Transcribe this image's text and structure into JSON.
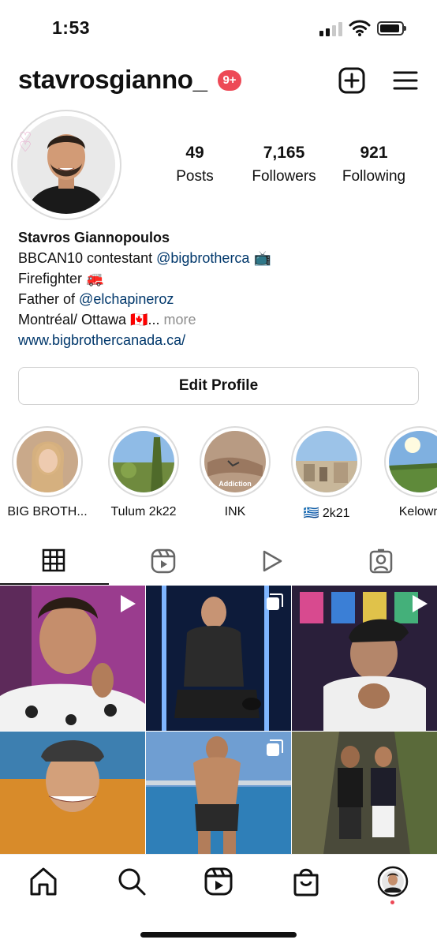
{
  "status_bar": {
    "time": "1:53",
    "signal_icon": "cellular-signal-icon",
    "wifi_icon": "wifi-icon",
    "battery_icon": "battery-icon"
  },
  "header": {
    "username": "stavrosgianno_",
    "notification_badge": "9+",
    "new_post_icon": "plus-square-icon",
    "menu_icon": "hamburger-menu-icon",
    "accent_color": "#ed4956"
  },
  "profile": {
    "avatar_icon": "profile-photo",
    "stats": [
      {
        "value": "49",
        "label": "Posts"
      },
      {
        "value": "7,165",
        "label": "Followers"
      },
      {
        "value": "921",
        "label": "Following"
      }
    ],
    "name": "Stavros Giannopoulos",
    "bio": {
      "line1_text": "BBCAN10 contestant ",
      "line1_mention": "@bigbrotherca",
      "line1_emoji": "📺",
      "line2": "Firefighter 🚒",
      "line3_text": "Father of ",
      "line3_mention": "@elchapineroz",
      "line4_text": "Montréal/ Ottawa 🇨🇦...",
      "line4_more": " more",
      "website": "www.bigbrothercanada.ca/"
    },
    "link_color": "#00376b",
    "edit_button": "Edit Profile"
  },
  "highlights": [
    {
      "label": "BIG BROTH..."
    },
    {
      "label": "Tulum 2k22"
    },
    {
      "label": "INK",
      "overlay_text": "Addiction"
    },
    {
      "label": "🇬🇷 2k21"
    },
    {
      "label": "Kelown"
    }
  ],
  "tabs": [
    {
      "name": "grid-icon",
      "active": true
    },
    {
      "name": "reels-icon",
      "active": false
    },
    {
      "name": "video-play-icon",
      "active": false
    },
    {
      "name": "tagged-person-icon",
      "active": false
    }
  ],
  "posts": [
    {
      "type": "reel",
      "badge_icon": "play-icon"
    },
    {
      "type": "carousel",
      "badge_icon": "carousel-icon"
    },
    {
      "type": "reel",
      "badge_icon": "play-icon"
    },
    {
      "type": "photo"
    },
    {
      "type": "carousel",
      "badge_icon": "carousel-icon"
    },
    {
      "type": "photo"
    }
  ],
  "bottom_nav": [
    {
      "name": "home-icon"
    },
    {
      "name": "search-icon"
    },
    {
      "name": "reels-icon"
    },
    {
      "name": "shop-bag-icon"
    },
    {
      "name": "profile-avatar-icon"
    }
  ]
}
